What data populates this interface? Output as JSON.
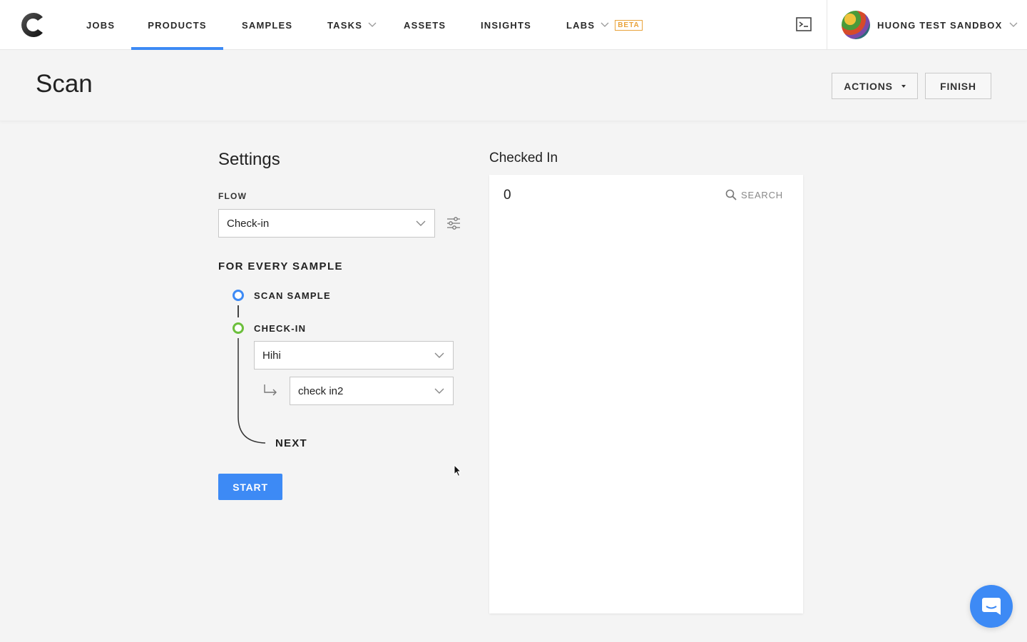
{
  "nav": {
    "items": [
      {
        "label": "JOBS"
      },
      {
        "label": "PRODUCTS"
      },
      {
        "label": "SAMPLES"
      },
      {
        "label": "TASKS"
      },
      {
        "label": "ASSETS"
      },
      {
        "label": "INSIGHTS"
      },
      {
        "label": "LABS",
        "badge": "BETA"
      }
    ],
    "active": "PRODUCTS",
    "user_name": "HUONG TEST SANDBOX"
  },
  "header": {
    "title": "Scan",
    "actions_label": "ACTIONS",
    "finish_label": "FINISH"
  },
  "settings": {
    "title": "Settings",
    "flow_label": "FLOW",
    "flow_value": "Check-in",
    "every_label": "FOR EVERY SAMPLE",
    "steps": {
      "scan": "SCAN SAMPLE",
      "checkin": "CHECK-IN",
      "checkin_location": "Hihi",
      "checkin_sublocation": "check in2",
      "next": "NEXT"
    },
    "start_label": "START"
  },
  "checked_in": {
    "title": "Checked In",
    "count": "0",
    "search_label": "SEARCH"
  },
  "colors": {
    "accent": "#3d8af5",
    "step_scan": "#3d8af5",
    "step_checkin": "#6cbf3c",
    "beta": "#e9a33b"
  },
  "icons": [
    "logo-icon",
    "chevron-down-icon",
    "terminal-icon",
    "filter-icon",
    "corner-arrow-icon",
    "search-icon",
    "chat-icon",
    "mouse-cursor-icon"
  ]
}
